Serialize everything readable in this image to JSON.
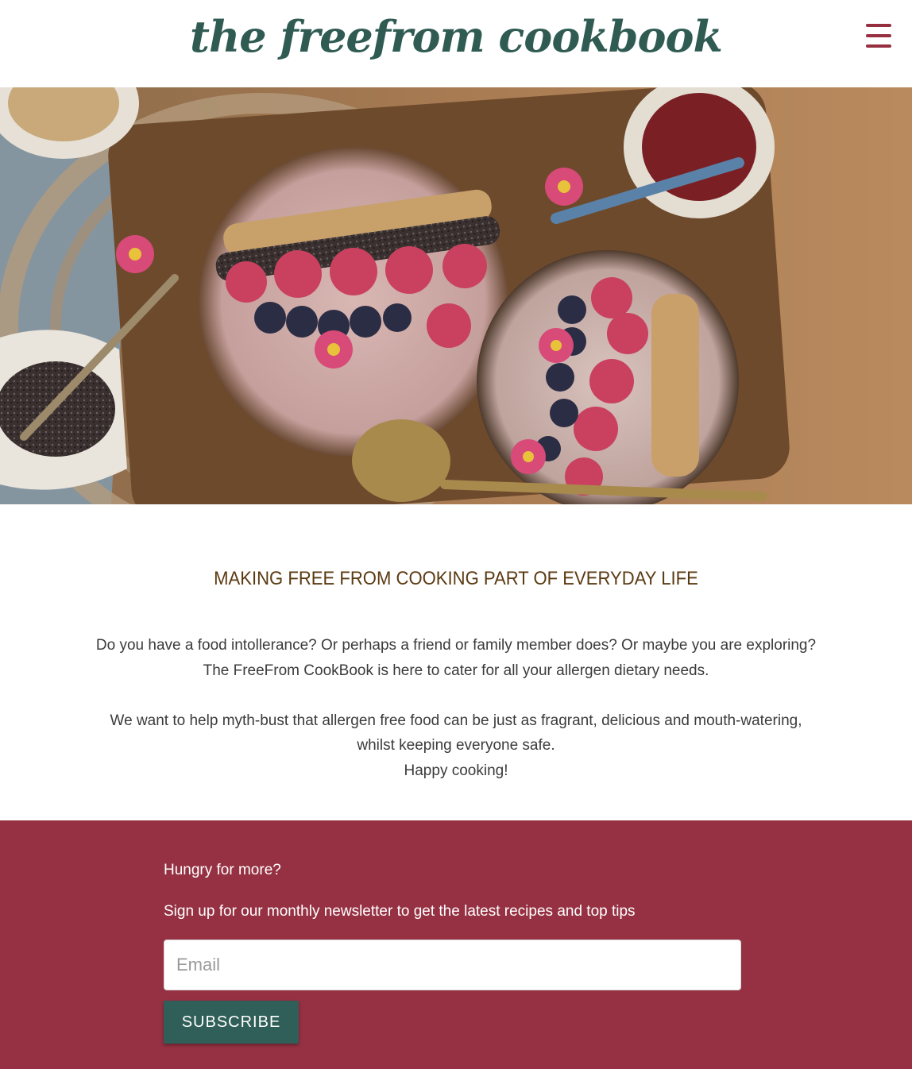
{
  "header": {
    "logo_text": "the freefrom cookbook",
    "menu_icon": "hamburger-menu-icon"
  },
  "hero": {
    "image_subject": "two smoothie bowls with raspberries, blueberries, oats, chia seeds and daisies on a wooden board"
  },
  "intro": {
    "heading": "MAKING FREE FROM COOKING PART OF EVERYDAY LIFE",
    "line1": "Do you have a food intollerance? Or perhaps a friend or family member does? Or maybe you are exploring?",
    "line2": "The FreeFrom CookBook is here to cater for all your allergen dietary needs.",
    "line3": "We want to help myth-bust that allergen free food can be just as fragrant, delicious and mouth-watering, whilst keeping everyone safe.",
    "line4": "Happy cooking!"
  },
  "newsletter": {
    "title": "Hungry for more?",
    "subtitle": "Sign up for our monthly newsletter to get the latest recipes and top tips",
    "email_placeholder": "Email",
    "email_value": "",
    "subscribe_label": "SUBSCRIBE"
  },
  "colors": {
    "brand_green": "#2f5b53",
    "brand_red": "#963143",
    "heading_brown": "#5b3a12"
  }
}
